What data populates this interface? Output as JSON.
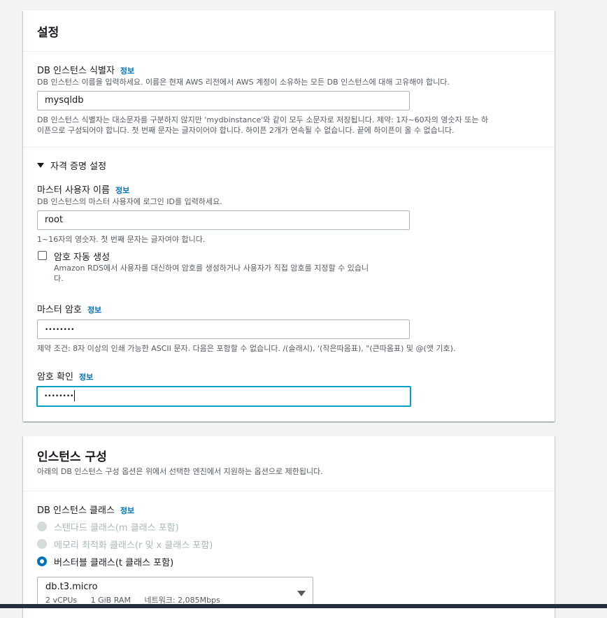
{
  "settings": {
    "title": "설정",
    "identifier": {
      "label": "DB 인스턴스 식별자",
      "info": "정보",
      "description": "DB 인스턴스 이름을 입력하세요. 이름은 현재 AWS 리전에서 AWS 계정이 소유하는 모든 DB 인스턴스에 대해 고유해야 합니다.",
      "value": "mysqldb",
      "constraint_line1": "DB 인스턴스 식별자는 대소문자를 구분하지 않지만 'mydbinstance'와 같이 모두 소문자로 저장됩니다. 제약: 1자~60자의 영숫자 또는 하",
      "constraint_line2": "이픈으로 구성되어야 합니다. 첫 번째 문자는 글자이어야 합니다. 하이픈 2개가 연속될 수 없습니다. 끝에 하이픈이 올 수 없습니다."
    },
    "credentials": {
      "section_label": "자격 증명 설정",
      "master_username": {
        "label": "마스터 사용자 이름",
        "info": "정보",
        "description": "DB 인스턴스의 마스터 사용자에 로그인 ID를 입력하세요.",
        "value": "root",
        "constraint": "1~16자의 영숫자. 첫 번째 문자는 글자여야 합니다."
      },
      "auto_password": {
        "label": "암호 자동 생성",
        "description_line1": "Amazon RDS에서 사용자를 대신하여 암호를 생성하거나 사용자가 직접 암호를 지정할 수 있습니",
        "description_line2": "다."
      },
      "master_password": {
        "label": "마스터 암호",
        "info": "정보",
        "value": "••••••••",
        "constraint": "제약 조건: 8자 이상의 인쇄 가능한 ASCII 문자. 다음은 포함할 수 없습니다. /(슬래시), '(작은따옴표), \"(큰따옴표) 및 @(앳 기호)."
      },
      "confirm_password": {
        "label": "암호 확인",
        "info": "정보",
        "value": "••••••••"
      }
    }
  },
  "instance_config": {
    "title": "인스턴스 구성",
    "description": "아래의 DB 인스턴스 구성 옵션은 위에서 선택한 엔진에서 지원하는 옵션으로 제한됩니다.",
    "class": {
      "label": "DB 인스턴스 클래스",
      "info": "정보",
      "options": [
        {
          "label": "스탠다드 클래스(m 클래스 포함)",
          "state": "disabled"
        },
        {
          "label": "메모리 최적화 클래스(r 및 x 클래스 포함)",
          "state": "disabled"
        },
        {
          "label": "버스터블 클래스(t 클래스 포함)",
          "state": "selected"
        }
      ],
      "selected": {
        "name": "db.t3.micro",
        "vcpus": "2 vCPUs",
        "ram": "1 GiB RAM",
        "network": "네트워크: 2,085Mbps"
      }
    }
  },
  "colors": {
    "link": "#0073bb",
    "focus_border": "#00a1c9",
    "radio_selected": "#0073bb",
    "page_bg": "#f2f3f3"
  }
}
